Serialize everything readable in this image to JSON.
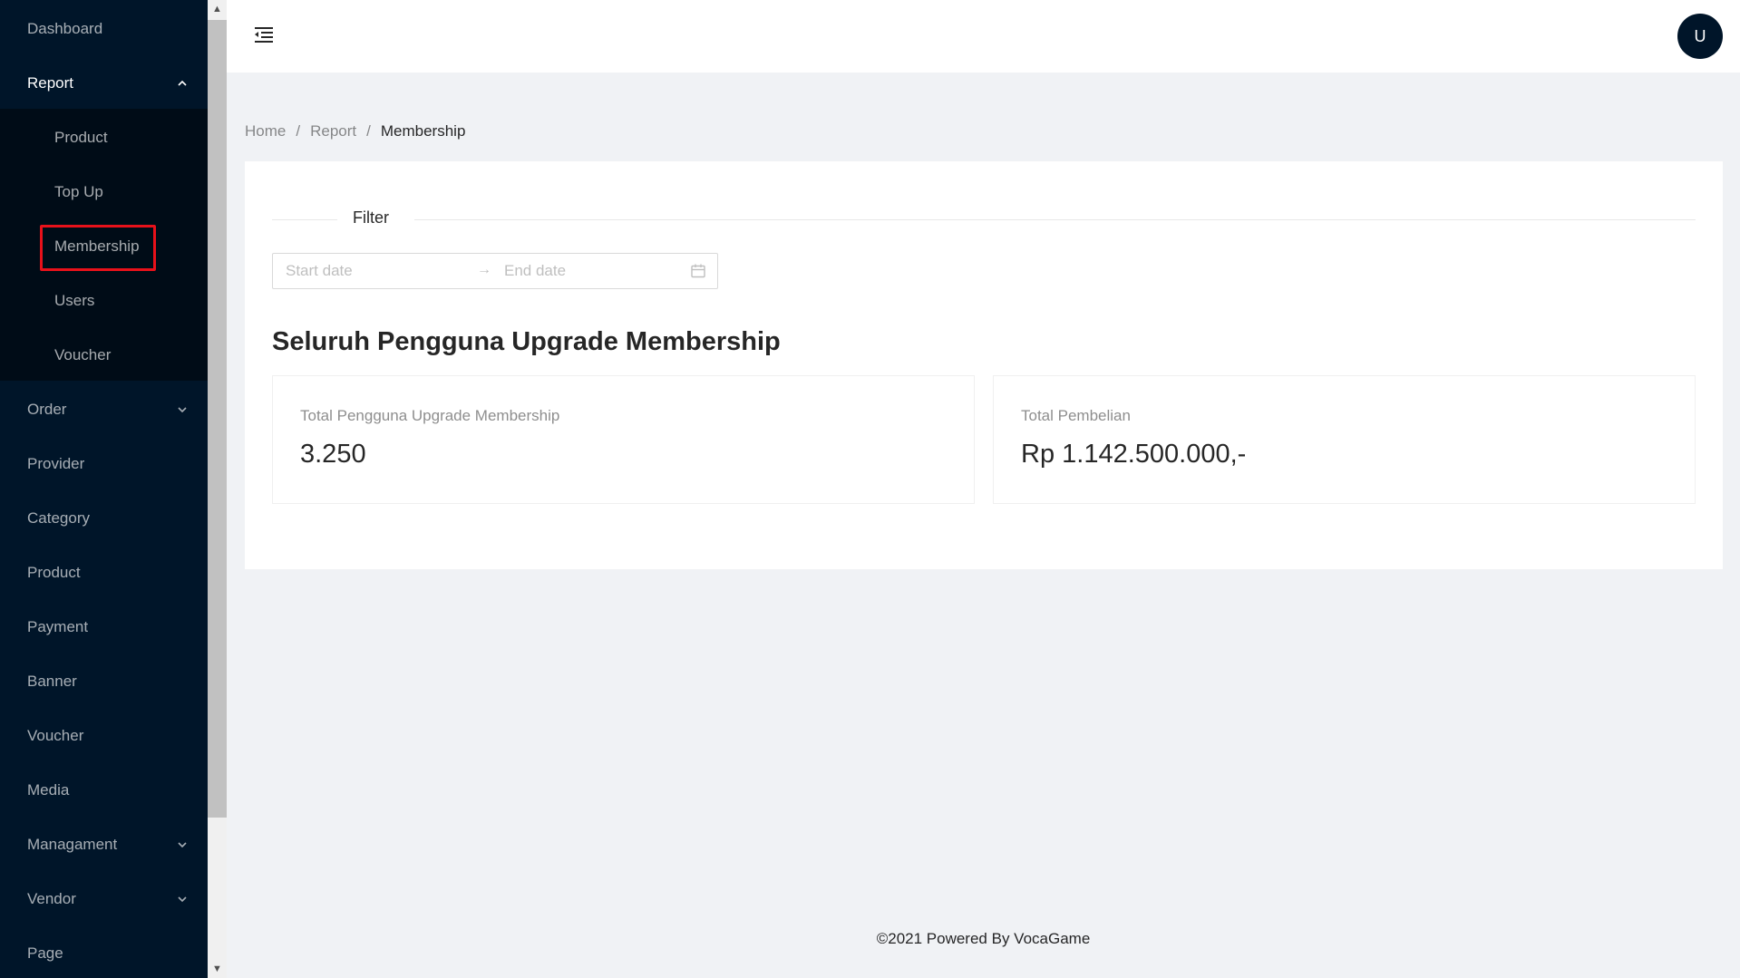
{
  "sidebar": {
    "items": [
      {
        "label": "Dashboard"
      },
      {
        "label": "Report"
      },
      {
        "label": "Order"
      },
      {
        "label": "Provider"
      },
      {
        "label": "Category"
      },
      {
        "label": "Product"
      },
      {
        "label": "Payment"
      },
      {
        "label": "Banner"
      },
      {
        "label": "Voucher"
      },
      {
        "label": "Media"
      },
      {
        "label": "Managament"
      },
      {
        "label": "Vendor"
      },
      {
        "label": "Page"
      }
    ],
    "report_submenu": [
      {
        "label": "Product"
      },
      {
        "label": "Top Up"
      },
      {
        "label": "Membership"
      },
      {
        "label": "Users"
      },
      {
        "label": "Voucher"
      }
    ]
  },
  "header": {
    "avatar_initial": "U"
  },
  "breadcrumb": {
    "home": "Home",
    "report": "Report",
    "current": "Membership",
    "separator": "/"
  },
  "filter": {
    "label": "Filter",
    "start_placeholder": "Start date",
    "end_placeholder": "End date",
    "arrow": "→"
  },
  "main": {
    "title": "Seluruh Pengguna Upgrade Membership",
    "stats": [
      {
        "label": "Total Pengguna Upgrade Membership",
        "value": "3.250"
      },
      {
        "label": "Total Pembelian",
        "value": "Rp 1.142.500.000,-"
      }
    ]
  },
  "footer": {
    "text": "©2021 Powered By VocaGame"
  },
  "colors": {
    "sidebar_bg": "#001529",
    "submenu_bg": "#000c17",
    "highlight": "#e8111a",
    "page_bg": "#f0f2f5"
  }
}
